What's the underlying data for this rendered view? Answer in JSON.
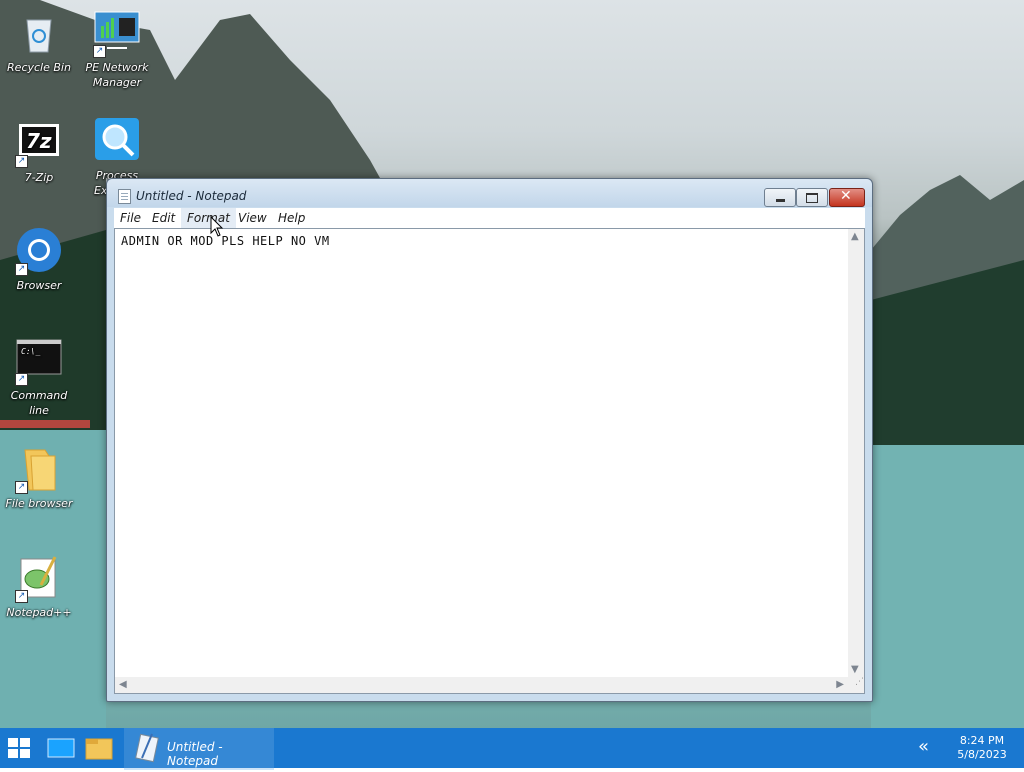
{
  "desktop": {
    "icons": [
      {
        "label": "Recycle Bin"
      },
      {
        "label": "PE Network Manager"
      },
      {
        "label": "7-Zip"
      },
      {
        "label": "Process Explorer"
      },
      {
        "label": "Browser"
      },
      {
        "label": "Command line"
      },
      {
        "label": "File browser"
      },
      {
        "label": "Notepad++"
      }
    ],
    "icon_names": [
      "recycle-bin-icon",
      "network-icon",
      "7zip-icon",
      "process-explorer-icon",
      "chrome-icon",
      "terminal-icon",
      "folder-icon",
      "notepadpp-icon"
    ]
  },
  "notepad": {
    "title": "Untitled - Notepad",
    "menus": [
      "File",
      "Edit",
      "Format",
      "View",
      "Help"
    ],
    "hovered_menu": "Format",
    "text": "ADMIN OR MOD PLS HELP NO VM"
  },
  "taskbar": {
    "active_app": "Untitled - Notepad",
    "time": "8:24 PM",
    "date": "5/8/2023"
  },
  "colors": {
    "taskbar": "#1a78d0",
    "window_frame": "#c9dced",
    "close_button": "#c3341f"
  }
}
